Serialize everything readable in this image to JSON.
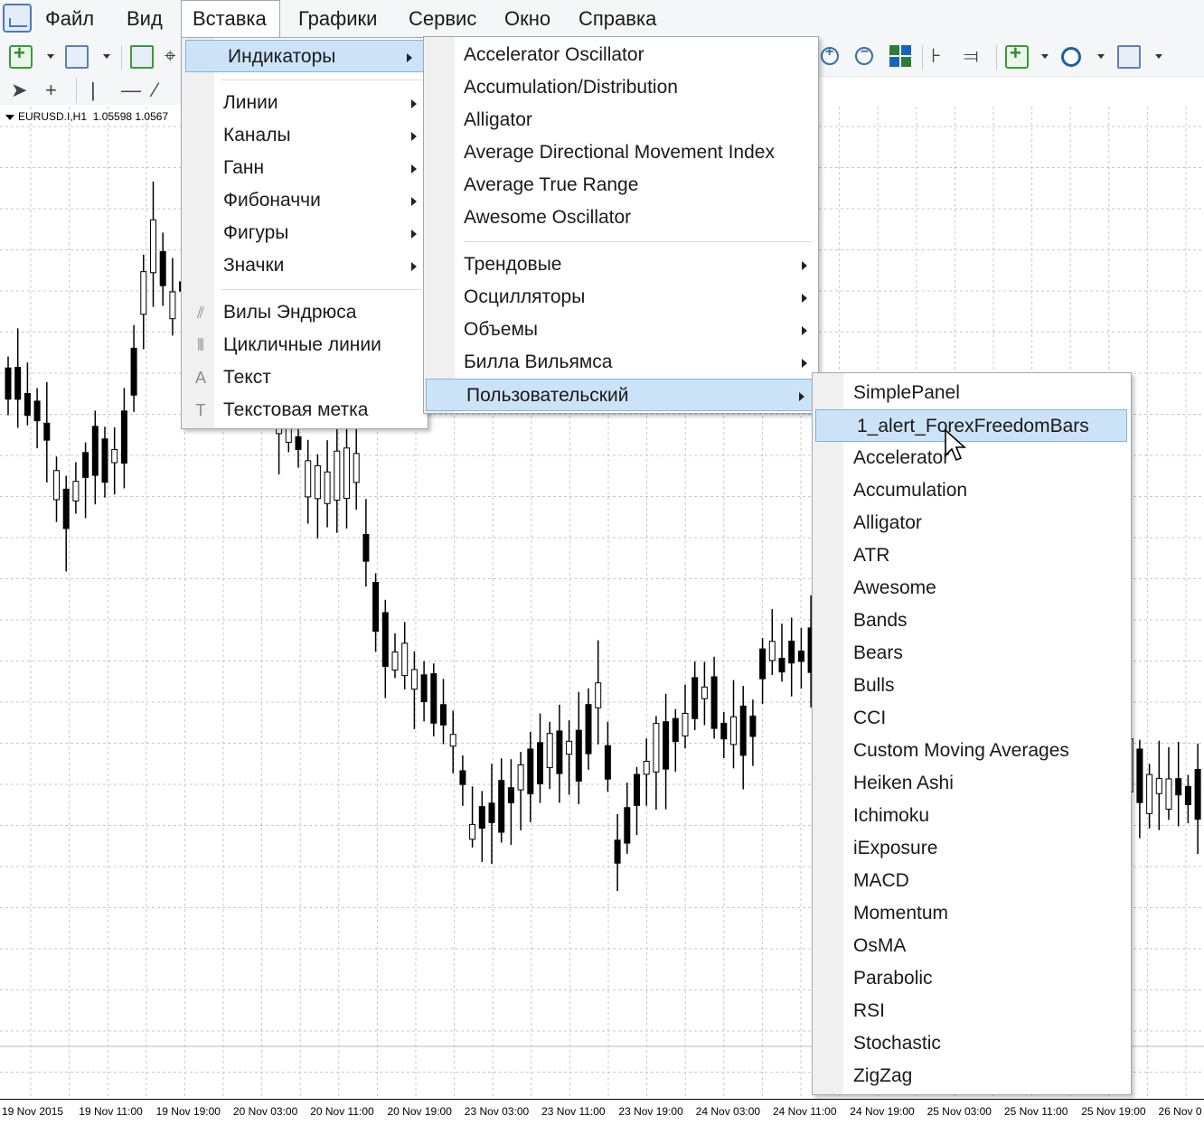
{
  "menubar": {
    "items": [
      "Файл",
      "Вид",
      "Вставка",
      "Графики",
      "Сервис",
      "Окно",
      "Справка"
    ],
    "open_item": "Вставка"
  },
  "chart": {
    "symbol": "EURUSD.I,H1",
    "bid": "1.05598",
    "ask": "1.0567",
    "xaxis_labels": [
      "19 Nov 2015",
      "19 Nov 11:00",
      "19 Nov 19:00",
      "20 Nov 03:00",
      "20 Nov 11:00",
      "20 Nov 19:00",
      "23 Nov 03:00",
      "23 Nov 11:00",
      "23 Nov 19:00",
      "24 Nov 03:00",
      "24 Nov 11:00",
      "24 Nov 19:00",
      "25 Nov 03:00",
      "25 Nov 11:00",
      "25 Nov 19:00",
      "26 Nov 0"
    ],
    "grid_color": "#c8c8c8",
    "candle_color": "#000000"
  },
  "insert_menu": {
    "items": [
      {
        "label": "Индикаторы",
        "submenu": true,
        "highlighted": true
      },
      {
        "label": "Линии",
        "submenu": true
      },
      {
        "label": "Каналы",
        "submenu": true
      },
      {
        "label": "Ганн",
        "submenu": true
      },
      {
        "label": "Фибоначчи",
        "submenu": true
      },
      {
        "label": "Фигуры",
        "submenu": true
      },
      {
        "label": "Значки",
        "submenu": true
      },
      {
        "label": "Вилы Эндрюса",
        "icon": "andrews-pitchfork-icon"
      },
      {
        "label": "Цикличные линии",
        "icon": "cycle-lines-icon"
      },
      {
        "label": "Текст",
        "icon": "text-icon"
      },
      {
        "label": "Текстовая метка",
        "icon": "text-label-icon"
      }
    ]
  },
  "indicators_menu": {
    "items": [
      {
        "label": "Accelerator Oscillator"
      },
      {
        "label": "Accumulation/Distribution"
      },
      {
        "label": "Alligator"
      },
      {
        "label": "Average Directional Movement Index"
      },
      {
        "label": "Average True Range"
      },
      {
        "label": "Awesome Oscillator"
      },
      {
        "label": "Трендовые",
        "submenu": true
      },
      {
        "label": "Осцилляторы",
        "submenu": true
      },
      {
        "label": "Объемы",
        "submenu": true
      },
      {
        "label": "Билла Вильямса",
        "submenu": true
      },
      {
        "label": "Пользовательский",
        "submenu": true,
        "highlighted": true
      }
    ]
  },
  "custom_menu": {
    "items": [
      "SimplePanel",
      "1_alert_ForexFreedomBars",
      "Accelerator",
      "Accumulation",
      "Alligator",
      "ATR",
      "Awesome",
      "Bands",
      "Bears",
      "Bulls",
      "CCI",
      "Custom Moving Averages",
      "Heiken Ashi",
      "Ichimoku",
      "iExposure",
      "MACD",
      "Momentum",
      "OsMA",
      "Parabolic",
      "RSI",
      "Stochastic",
      "ZigZag"
    ],
    "highlighted": "1_alert_ForexFreedomBars"
  },
  "colors": {
    "highlight_bg": "#cce3f7",
    "highlight_border": "#7fb3e0"
  }
}
